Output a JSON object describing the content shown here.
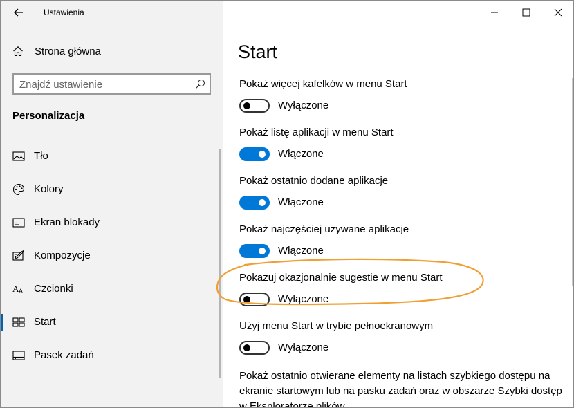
{
  "window": {
    "title": "Ustawienia",
    "controls": {
      "minimize": "—",
      "maximize": "☐",
      "close": "✕"
    }
  },
  "sidebar": {
    "home_label": "Strona główna",
    "search_placeholder": "Znajdź ustawienie",
    "section_title": "Personalizacja",
    "items": [
      {
        "label": "Tło",
        "icon": "image-icon",
        "selected": false
      },
      {
        "label": "Kolory",
        "icon": "palette-icon",
        "selected": false
      },
      {
        "label": "Ekran blokady",
        "icon": "lock-screen-icon",
        "selected": false
      },
      {
        "label": "Kompozycje",
        "icon": "themes-icon",
        "selected": false
      },
      {
        "label": "Czcionki",
        "icon": "fonts-icon",
        "selected": false
      },
      {
        "label": "Start",
        "icon": "start-icon",
        "selected": true
      },
      {
        "label": "Pasek zadań",
        "icon": "taskbar-icon",
        "selected": false
      }
    ]
  },
  "main": {
    "page_title": "Start",
    "settings": [
      {
        "label": "Pokaż więcej kafelków w menu Start",
        "on": false,
        "state": "Wyłączone"
      },
      {
        "label": "Pokaż listę aplikacji w menu Start",
        "on": true,
        "state": "Włączone"
      },
      {
        "label": "Pokaż ostatnio dodane aplikacje",
        "on": true,
        "state": "Włączone"
      },
      {
        "label": "Pokaż najczęściej używane aplikacje",
        "on": true,
        "state": "Włączone"
      },
      {
        "label": "Pokazuj okazjonalnie sugestie w menu Start",
        "on": false,
        "state": "Wyłączone"
      },
      {
        "label": "Użyj menu Start w trybie pełnoekranowym",
        "on": false,
        "state": "Wyłączone"
      }
    ],
    "last_setting_label": "Pokaż ostatnio otwierane elementy na listach szybkiego dostępu na ekranie startowym lub na pasku zadań oraz w obszarze Szybki dostęp w Eksploratorze plików"
  },
  "colors": {
    "accent": "#0078d7",
    "annotation": "#f0a033",
    "sidebar_bg": "#f2f2f2"
  }
}
